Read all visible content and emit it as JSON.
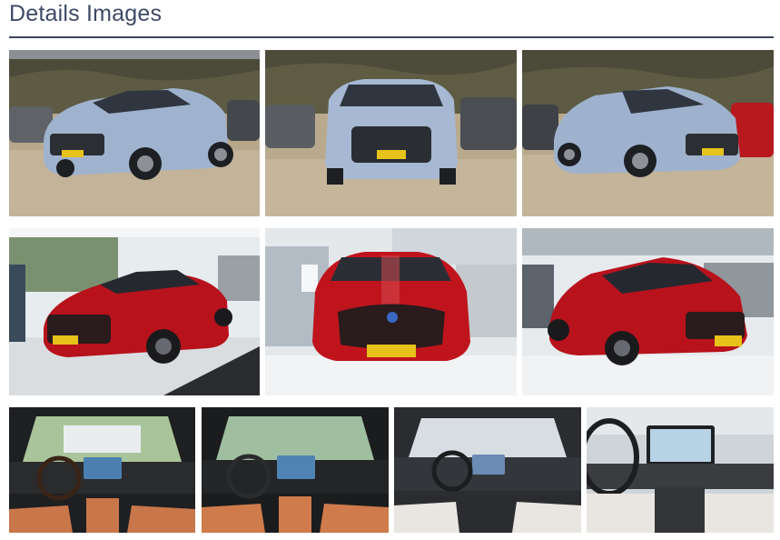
{
  "section": {
    "title": "Details Images"
  },
  "colors": {
    "title": "#3d4a66",
    "rule": "#3d4658",
    "blue_car": "#9fb3cf",
    "red_car": "#b8121c",
    "orange_leather": "#c8764a",
    "white_leather": "#e9e6e1"
  },
  "gallery": {
    "rows": [
      {
        "name": "exterior-blue",
        "photos": [
          {
            "scene": "blue-suv-front-left",
            "car_color": "blue",
            "setting": "outdoor-lot"
          },
          {
            "scene": "blue-suv-front",
            "car_color": "blue",
            "setting": "outdoor-lot"
          },
          {
            "scene": "blue-suv-front-right",
            "car_color": "blue",
            "setting": "outdoor-lot"
          }
        ]
      },
      {
        "name": "exterior-red",
        "photos": [
          {
            "scene": "red-suv-front-left",
            "car_color": "red",
            "setting": "showroom"
          },
          {
            "scene": "red-suv-front",
            "car_color": "red",
            "setting": "showroom"
          },
          {
            "scene": "red-suv-front-right",
            "car_color": "red",
            "setting": "showroom"
          }
        ]
      },
      {
        "name": "interior",
        "photos": [
          {
            "scene": "dashboard-orange-seats",
            "trim": "orange"
          },
          {
            "scene": "dashboard-orange-seats-2",
            "trim": "orange"
          },
          {
            "scene": "dashboard-white-seats",
            "trim": "white"
          },
          {
            "scene": "dashboard-white-closeup",
            "trim": "white"
          }
        ]
      }
    ]
  }
}
